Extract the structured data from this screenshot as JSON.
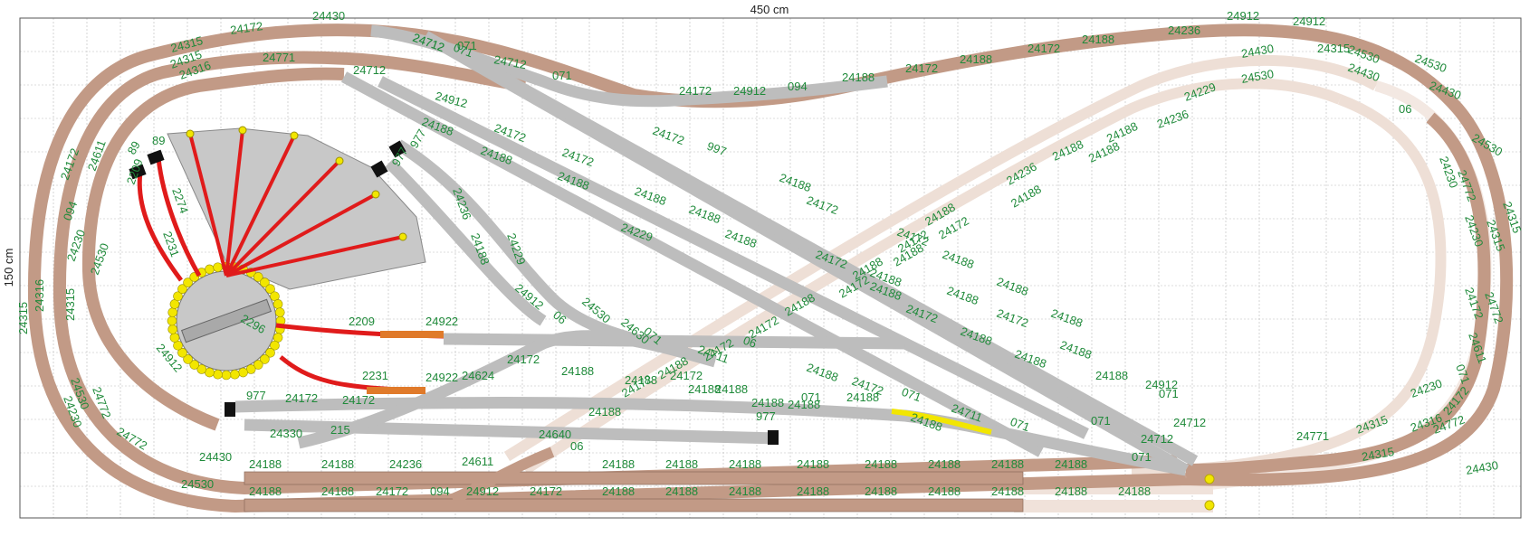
{
  "plan": {
    "width_label": "450 cm",
    "height_label": "150 cm"
  },
  "colors": {
    "grid": "#b9b9b9",
    "background": "#ffffff",
    "main_track": "#c29a86",
    "ghost_track": "#f0e2da",
    "gray_track": "#bdbdbd",
    "red_track": "#e01b1b",
    "orange_track": "#e07a2a",
    "yellow_track": "#f2e600",
    "label": "#1f8a3a",
    "bumper": "#111111"
  },
  "labels": {
    "top_left": [
      "24315",
      "24172",
      "24430",
      "24315",
      "24316",
      "24771",
      "24712",
      "071",
      "24712",
      "071",
      "24912",
      "24172",
      "24912",
      "094",
      "24188",
      "24172",
      "24188",
      "24172",
      "24188",
      "24236",
      "24912",
      "24912"
    ],
    "left_side": [
      "24172",
      "24611",
      "094",
      "24230",
      "24530",
      "24912",
      "24772",
      "24315",
      "24316",
      "24315",
      "24230",
      "24530",
      "24772"
    ],
    "turntable_area": [
      "89",
      "89",
      "2209",
      "2274",
      "2231",
      "2296",
      "2209",
      "24922",
      "2231",
      "24922",
      "24624",
      "977",
      "24172",
      "24172",
      "24330",
      "215"
    ],
    "diagonal": [
      "24712",
      "071",
      "24188",
      "24172",
      "24188",
      "24172",
      "24188",
      "24188",
      "24229",
      "977",
      "977",
      "24236",
      "24188",
      "24229",
      "24912",
      "24530",
      "06",
      "24630",
      "071",
      "24711",
      "06",
      "24172",
      "24188",
      "24188",
      "24188",
      "24172",
      "24172",
      "24188",
      "997",
      "24188",
      "24172",
      "24188",
      "24188",
      "24172",
      "24188",
      "24172",
      "24188",
      "24188",
      "24188",
      "24188",
      "24172",
      "24188",
      "24188",
      "24188",
      "24172",
      "24188",
      "24188",
      "24912",
      "071",
      "071",
      "24712",
      "071",
      "24712"
    ],
    "yard_upper": [
      "24172",
      "24188",
      "24188",
      "24188",
      "24188",
      "24188",
      "977",
      "071",
      "24188",
      "071",
      "24711",
      "071"
    ],
    "bottom_rows": [
      "24430",
      "24188",
      "24188",
      "24236",
      "24611",
      "24640",
      "06",
      "24188",
      "24188",
      "24188",
      "24188",
      "24188",
      "24188",
      "24188",
      "24188",
      "24530",
      "24188",
      "24188",
      "24172",
      "094",
      "24912",
      "24172",
      "24188",
      "24188",
      "24188",
      "24188",
      "24188",
      "24188",
      "24188",
      "24188",
      "24188"
    ],
    "right_side": [
      "24530",
      "24430",
      "24315",
      "24530",
      "24430",
      "06",
      "24530",
      "24230",
      "24772",
      "24315",
      "24230",
      "24315",
      "24172",
      "24772",
      "24611",
      "071",
      "24230",
      "24315",
      "24316",
      "24772",
      "24172",
      "24315",
      "24430",
      "24771",
      "24712"
    ],
    "ghost_diagonal": [
      "24430",
      "24530",
      "24229",
      "24236",
      "24188",
      "24188",
      "24188",
      "24236",
      "24188",
      "24188",
      "24172",
      "24188",
      "24172",
      "24188",
      "24172",
      "24188",
      "24172",
      "24172",
      "24188",
      "24172"
    ]
  }
}
